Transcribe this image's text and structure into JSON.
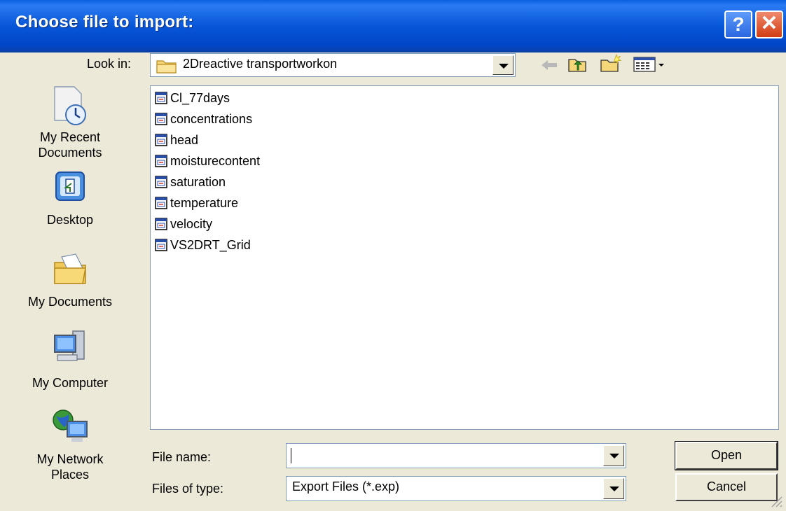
{
  "dialog": {
    "title": "Choose file to import:",
    "help_label": "?",
    "close_label": "✕"
  },
  "lookin": {
    "label": "Look in:",
    "value": "2Dreactive transportworkon"
  },
  "places": [
    {
      "label_line1": "My Recent",
      "label_line2": "Documents",
      "icon": "recent-documents-icon"
    },
    {
      "label_line1": "Desktop",
      "label_line2": "",
      "icon": "desktop-icon"
    },
    {
      "label_line1": "My Documents",
      "label_line2": "",
      "icon": "my-documents-icon"
    },
    {
      "label_line1": "My Computer",
      "label_line2": "",
      "icon": "my-computer-icon"
    },
    {
      "label_line1": "My Network",
      "label_line2": "Places",
      "icon": "network-places-icon"
    }
  ],
  "files": [
    {
      "name": "Cl_77days"
    },
    {
      "name": "concentrations"
    },
    {
      "name": "head"
    },
    {
      "name": "moisturecontent"
    },
    {
      "name": "saturation"
    },
    {
      "name": "temperature"
    },
    {
      "name": "velocity"
    },
    {
      "name": "VS2DRT_Grid"
    }
  ],
  "filename": {
    "label": "File name:",
    "value": ""
  },
  "filetype": {
    "label": "Files of type:",
    "value": "Export Files (*.exp)"
  },
  "buttons": {
    "open": "Open",
    "cancel": "Cancel"
  },
  "colors": {
    "titlebar": "#0756d8",
    "dialog_bg": "#ece9d8",
    "list_bg": "#ffffff"
  }
}
